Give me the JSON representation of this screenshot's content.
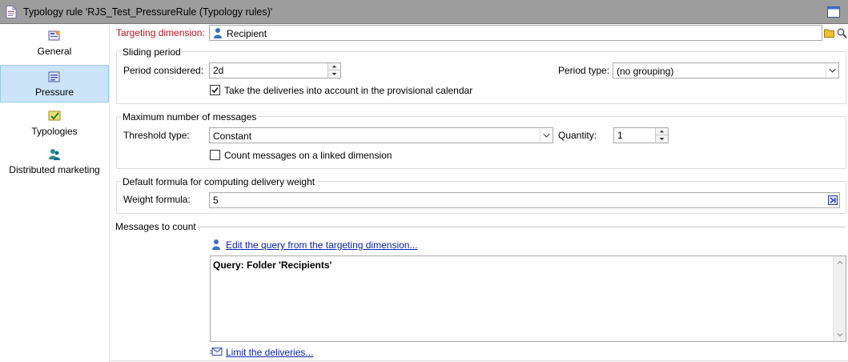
{
  "window": {
    "title": "Typology rule 'RJS_Test_PressureRule (Typology rules)'",
    "doc_icon": "document-icon",
    "restore_icon": "window-icon"
  },
  "sidebar": {
    "items": [
      {
        "label": "General",
        "icon": "general-icon",
        "active": false
      },
      {
        "label": "Pressure",
        "icon": "pressure-icon",
        "active": true
      },
      {
        "label": "Typologies",
        "icon": "typologies-icon",
        "active": false
      },
      {
        "label": "Distributed marketing",
        "icon": "distributed-marketing-icon",
        "active": false
      }
    ]
  },
  "targeting": {
    "label": "Targeting dimension:",
    "value": "Recipient",
    "label_color": "#c0101e"
  },
  "sliding_period": {
    "title": "Sliding period",
    "period_considered_label": "Period considered:",
    "period_considered_value": "2d",
    "provisional_label": "Take the deliveries into account in the provisional calendar",
    "provisional_checked": true,
    "period_type_label": "Period type:",
    "period_type_value": "(no grouping)"
  },
  "max_messages": {
    "title": "Maximum number of messages",
    "threshold_label": "Threshold type:",
    "threshold_value": "Constant",
    "quantity_label": "Quantity:",
    "quantity_value": "1",
    "linked_label": "Count messages on a linked dimension",
    "linked_checked": false
  },
  "weight": {
    "title": "Default formula for computing delivery weight",
    "formula_label": "Weight formula:",
    "formula_value": "5"
  },
  "messages": {
    "title": "Messages to count",
    "edit_query_link": "Edit the query from the targeting dimension...",
    "query_text": "Query: Folder 'Recipients'",
    "limit_link": "Limit the deliveries..."
  },
  "colors": {
    "titlebar": "#9d9d9d",
    "active_sidebar": "#cce4f7",
    "link": "#0b23a8"
  }
}
